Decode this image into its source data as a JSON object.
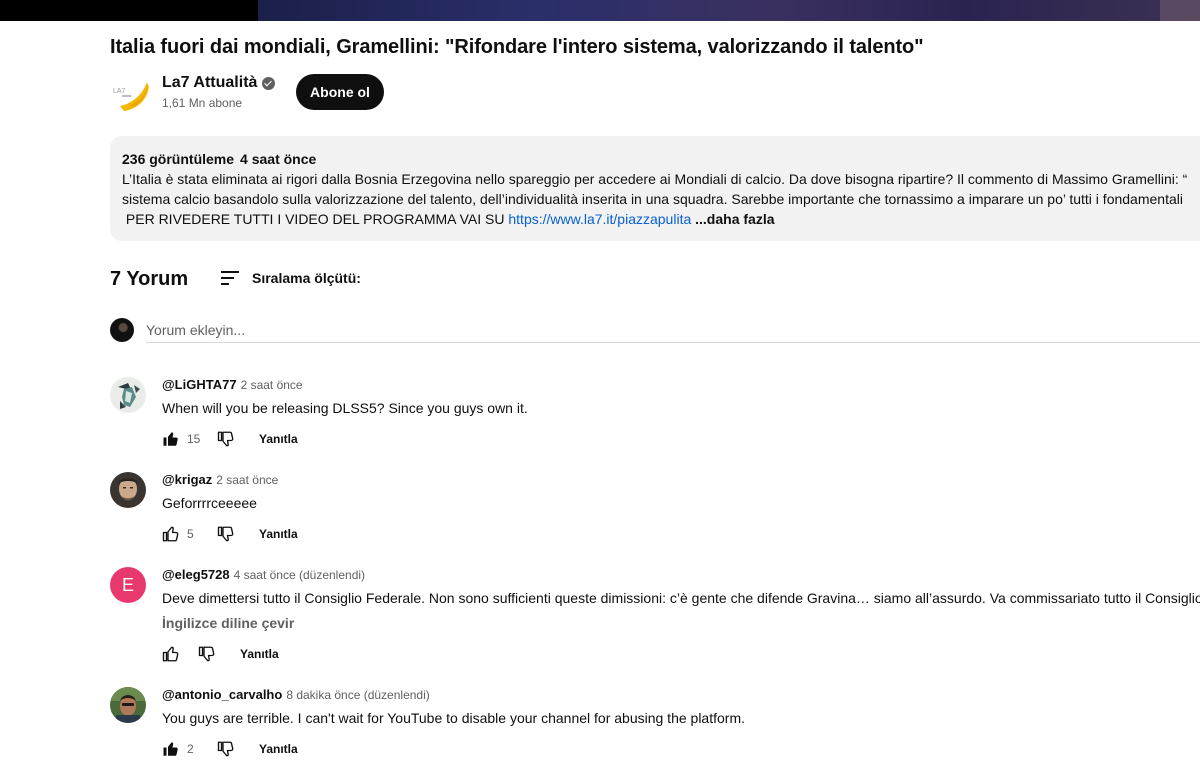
{
  "video": {
    "title": "Italia fuori dai mondiali, Gramellini: \"Rifondare l'intero sistema, valorizzando il talento\""
  },
  "channel": {
    "name": "La7 Attualità",
    "subscribers": "1,61 Mn abone",
    "subscribe_label": "Abone ol",
    "logo_text": "LA7"
  },
  "description": {
    "views": "236 görüntüleme",
    "time": "4 saat önce",
    "line1": "L’Italia è stata eliminata ai rigori dalla Bosnia Erzegovina nello spareggio per accedere ai Mondiali di calcio. Da dove bisogna ripartire? Il commento di Massimo Gramellini: “",
    "line2": "sistema calcio basandolo sulla valorizzazione del talento, dell’individualità inserita in una squadra. Sarebbe importante che tornassimo a imparare un po’ tutti i fondamentali",
    "line3_prefix": " PER RIVEDERE TUTTI I VIDEO DEL PROGRAMMA VAI SU ",
    "link": "https://www.la7.it/piazzapulita",
    "more": "...daha fazla"
  },
  "comments_header": {
    "count_label": "7 Yorum",
    "sort_label": "Sıralama ölçütü:"
  },
  "add_comment": {
    "placeholder": "Yorum ekleyin..."
  },
  "comments": [
    {
      "author": "@LiGHTA77",
      "time": "2 saat önce",
      "text": "When will you be releasing DLSS5? Since you guys own it.",
      "likes": "15",
      "reply": "Yanıtla"
    },
    {
      "author": "@krigaz",
      "time": "2 saat önce",
      "text": "Geforrrrceeeee",
      "likes": "5",
      "reply": "Yanıtla"
    },
    {
      "author": "@eleg5728",
      "time": "4 saat önce (düzenlendi)",
      "text": "Deve dimettersi tutto il Consiglio Federale. Non sono sufficienti queste dimissioni: c’è gente che difende Gravina… siamo all’assurdo. Va commissariato tutto il Consiglio",
      "translate": "İngilizce diline çevir",
      "avatar_letter": "E",
      "reply": "Yanıtla"
    },
    {
      "author": "@antonio_carvalho",
      "time": "8 dakika önce (düzenlendi)",
      "text": "You guys are terrible. I can't wait for YouTube to disable your channel for abusing the platform.",
      "likes": "2",
      "reply": "Yanıtla"
    }
  ],
  "colors": {
    "link": "#065fd4",
    "subscribe_bg": "#0f0f0f",
    "avatar_e": "#e8396f",
    "logo_yellow": "#f5b800"
  }
}
